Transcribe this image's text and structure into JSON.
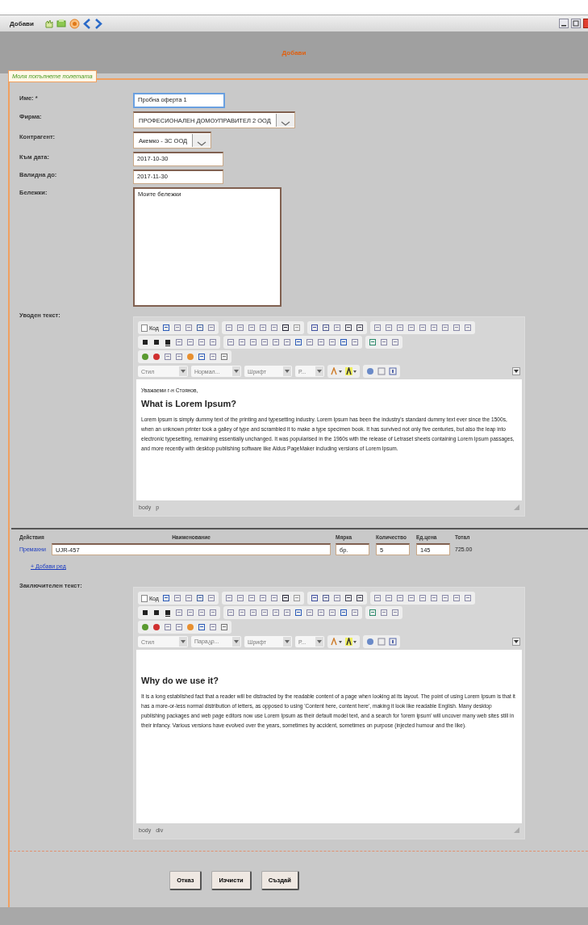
{
  "window": {
    "title": "Добави",
    "heading": "Добави"
  },
  "fieldset": {
    "legend": "Моля попълнете полетата"
  },
  "fields": [
    {
      "label": "Име: *",
      "kind": "text",
      "value": "Пробна оферта 1",
      "focused": true
    },
    {
      "label": "Фирма:",
      "kind": "select",
      "value": "ПРОФЕСИОНАЛЕН ДОМОУПРАВИТЕЛ 2 ООД",
      "focused": false
    },
    {
      "label": "Контрагент:",
      "kind": "select",
      "value": "Акемко - 3С ООД",
      "focused": false
    },
    {
      "label": "Към дата:",
      "kind": "date",
      "value": "2017-10-30",
      "focused": false
    },
    {
      "label": "Валидна до:",
      "kind": "date",
      "value": "2017-11-30",
      "focused": false
    },
    {
      "label": "Бележки:",
      "kind": "textarea",
      "value": "Моите бележки",
      "focused": false
    }
  ],
  "intro": {
    "label": "Уводен текст:",
    "editor": {
      "source_label": "Код",
      "dropdowns": [
        "Стил",
        "Нормал...",
        "Шрифт",
        "Р..."
      ],
      "content": [
        {
          "kind": "paragraph",
          "text": "Уважаеми г-н Стоянов,"
        },
        {
          "kind": "heading",
          "text": "What is Lorem Ipsum?"
        },
        {
          "kind": "paragraph",
          "text": "Lorem Ipsum is simply dummy text of the printing and typesetting industry. Lorem Ipsum has been the industry's standard dummy text ever since the 1500s, when an unknown printer took a galley of type and scrambled it to make a type specimen book. It has survived not only five centuries, but also the leap into electronic typesetting, remaining essentially unchanged. It was popularised in the 1960s with the release of Letraset sheets containing Lorem Ipsum passages, and more recently with desktop publishing software like Aldus PageMaker including versions of Lorem Ipsum."
        }
      ],
      "path": [
        "body",
        "p"
      ]
    }
  },
  "items": {
    "columns": [
      "Действия",
      "Наименование",
      "Мярка",
      "Количество",
      "Ед.цена",
      "Тотал"
    ],
    "rows": [
      {
        "action": "Премахни",
        "name": "UJR-457",
        "unit": "бр.",
        "quantity": "5",
        "unit_price": "145",
        "total": "725.00"
      }
    ],
    "add_link": "+ Добави ред"
  },
  "outro": {
    "label": "Заключителен текст:",
    "editor": {
      "source_label": "Код",
      "dropdowns": [
        "Стил",
        "Параგр...",
        "Шрифт",
        "Р..."
      ],
      "content": [
        {
          "kind": "spacer"
        },
        {
          "kind": "heading",
          "text": "Why do we use it?"
        },
        {
          "kind": "paragraph",
          "text": "It is a long established fact that a reader will be distracted by the readable content of a page when looking at its layout. The point of using Lorem Ipsum is that it has a more-or-less normal distribution of letters, as opposed to using 'Content here, content here', making it look like readable English. Many desktop publishing packages and web page editors now use Lorem Ipsum as their default model text, and a search for 'lorem ipsum' will uncover many web sites still in their infancy. Various versions have evolved over the years, sometimes by accident, sometimes on purpose (injected humour and the like)."
        }
      ],
      "path": [
        "body",
        "div"
      ]
    }
  },
  "buttons": [
    "Отказ",
    "Изчисти",
    "Създай"
  ]
}
